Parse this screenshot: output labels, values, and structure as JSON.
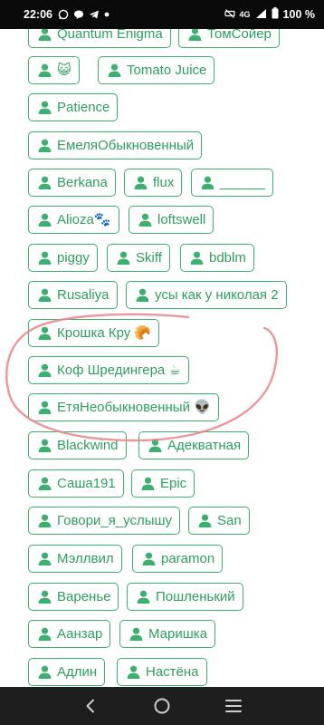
{
  "status_bar": {
    "time": "22:06",
    "network": "4G",
    "battery": "100 %"
  },
  "tags": [
    {
      "label": "Quantum Enigma"
    },
    {
      "label": "ТомСойер"
    },
    {
      "label": "😺"
    },
    {
      "label": "Tomato Juice"
    },
    {
      "label": "Patience"
    },
    {
      "label": "ЕмеляОбыкновенный"
    },
    {
      "label": "Berkana"
    },
    {
      "label": "flux"
    },
    {
      "label": "______"
    },
    {
      "label": "Alioza🐾"
    },
    {
      "label": "loftswell"
    },
    {
      "label": "piggy"
    },
    {
      "label": "Skiff"
    },
    {
      "label": "bdblm"
    },
    {
      "label": "Rusaliya"
    },
    {
      "label": "усы как у николая 2"
    },
    {
      "label": "Крошка Кру 🥐"
    },
    {
      "label": "Коф Шредингера ☕"
    },
    {
      "label": "ЕтяНеобыкновенный 👽"
    },
    {
      "label": "Blackwind"
    },
    {
      "label": "Адекватная"
    },
    {
      "label": "Саша191"
    },
    {
      "label": "Epic"
    },
    {
      "label": "Говори_я_услышу"
    },
    {
      "label": "San"
    },
    {
      "label": "Мэллвил"
    },
    {
      "label": "paramon"
    },
    {
      "label": "Варенье"
    },
    {
      "label": "Пошленький"
    },
    {
      "label": "Аанзар"
    },
    {
      "label": "Маришка"
    },
    {
      "label": "Адлин"
    },
    {
      "label": "Настёна"
    }
  ],
  "colors": {
    "tag_border": "#3cb06f",
    "tag_text": "#2f9e5f",
    "highlight": "#e8868a"
  }
}
